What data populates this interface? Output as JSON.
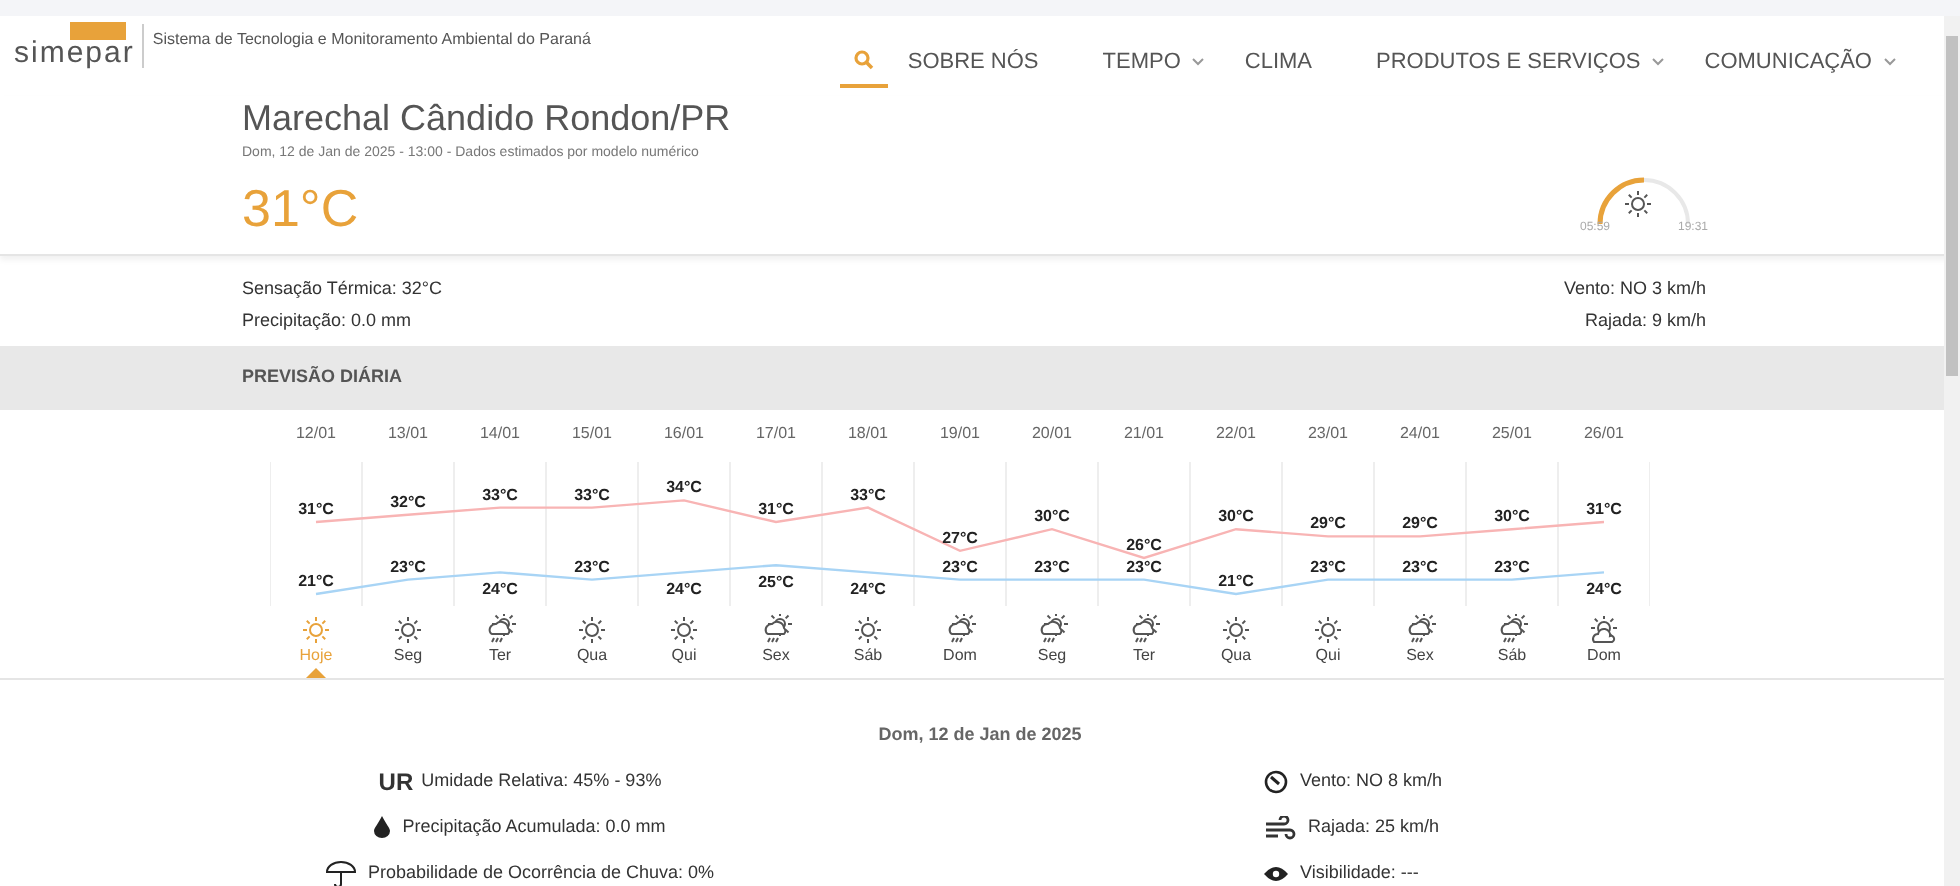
{
  "header": {
    "logo_text": "simepar",
    "tagline": "Sistema de Tecnologia e Monitoramento Ambiental do Paraná"
  },
  "nav": [
    {
      "label": "SOBRE NÓS",
      "dropdown": false
    },
    {
      "label": "TEMPO",
      "dropdown": true
    },
    {
      "label": "CLIMA",
      "dropdown": false
    },
    {
      "label": "PRODUTOS E SERVIÇOS",
      "dropdown": true
    },
    {
      "label": "COMUNICAÇÃO",
      "dropdown": true
    }
  ],
  "current": {
    "city": "Marechal Cândido Rondon/PR",
    "subtitle": "Dom, 12 de Jan de 2025 - 13:00 - Dados estimados por modelo numérico",
    "temperature": "31°C",
    "sunrise": "05:59",
    "sunset": "19:31",
    "sun_arc": {
      "level": 0.5
    }
  },
  "conditions": {
    "left": [
      "Sensação Térmica: 32°C",
      "Precipitação: 0.0 mm"
    ],
    "right": [
      "Vento: NO 3 km/h",
      "Rajada: 9 km/h"
    ]
  },
  "daily": {
    "title": "PREVISÃO DIÁRIA",
    "days": [
      {
        "label": "Hoje",
        "kind": "sun",
        "selected": true
      },
      {
        "label": "Seg",
        "kind": "sun",
        "selected": false
      },
      {
        "label": "Ter",
        "kind": "storm",
        "selected": false
      },
      {
        "label": "Qua",
        "kind": "sun",
        "selected": false
      },
      {
        "label": "Qui",
        "kind": "sun",
        "selected": false
      },
      {
        "label": "Sex",
        "kind": "storm",
        "selected": false
      },
      {
        "label": "Sáb",
        "kind": "sun",
        "selected": false
      },
      {
        "label": "Dom",
        "kind": "storm",
        "selected": false
      },
      {
        "label": "Seg",
        "kind": "storm",
        "selected": false
      },
      {
        "label": "Ter",
        "kind": "storm",
        "selected": false
      },
      {
        "label": "Qua",
        "kind": "sun",
        "selected": false
      },
      {
        "label": "Qui",
        "kind": "sun",
        "selected": false
      },
      {
        "label": "Sex",
        "kind": "storm",
        "selected": false
      },
      {
        "label": "Sáb",
        "kind": "storm",
        "selected": false
      },
      {
        "label": "Dom",
        "kind": "partly",
        "selected": false
      }
    ],
    "chart_data": {
      "type": "line",
      "categories": [
        "12/01",
        "13/01",
        "14/01",
        "15/01",
        "16/01",
        "17/01",
        "18/01",
        "19/01",
        "20/01",
        "21/01",
        "22/01",
        "23/01",
        "24/01",
        "25/01",
        "26/01"
      ],
      "data_labels": true,
      "series": [
        {
          "color": "#f8b4b4",
          "values": [
            31,
            32,
            33,
            33,
            34,
            31,
            33,
            27,
            30,
            26,
            30,
            29,
            29,
            30,
            31
          ],
          "value_labels": [
            "31°C",
            "32°C",
            "33°C",
            "33°C",
            "34°C",
            "31°C",
            "33°C",
            "27°C",
            "30°C",
            "26°C",
            "30°C",
            "29°C",
            "29°C",
            "30°C",
            "31°C"
          ]
        },
        {
          "color": "#a8d4f5",
          "values": [
            21,
            23,
            24,
            23,
            24,
            25,
            24,
            23,
            23,
            23,
            21,
            23,
            23,
            23,
            24
          ],
          "value_labels": [
            "21°C",
            "23°C",
            "24°C",
            "23°C",
            "24°C",
            "25°C",
            "24°C",
            "23°C",
            "23°C",
            "23°C",
            "21°C",
            "23°C",
            "23°C",
            "23°C",
            "24°C"
          ]
        }
      ]
    }
  },
  "detail": {
    "date": "Dom, 12 de Jan de 2025",
    "left": [
      {
        "kind": "humidity",
        "badge": "UR",
        "text": "Umidade Relativa: 45% - 93%"
      },
      {
        "kind": "rain",
        "text": "Precipitação Acumulada: 0.0 mm"
      },
      {
        "kind": "umbrella",
        "text": "Probabilidade de Ocorrência de Chuva: 0%"
      }
    ],
    "right": [
      {
        "kind": "wind",
        "text": "Vento: NO 8 km/h"
      },
      {
        "kind": "gust",
        "text": "Rajada: 25 km/h"
      },
      {
        "kind": "visibility",
        "text": "Visibilidade: ---"
      }
    ]
  }
}
